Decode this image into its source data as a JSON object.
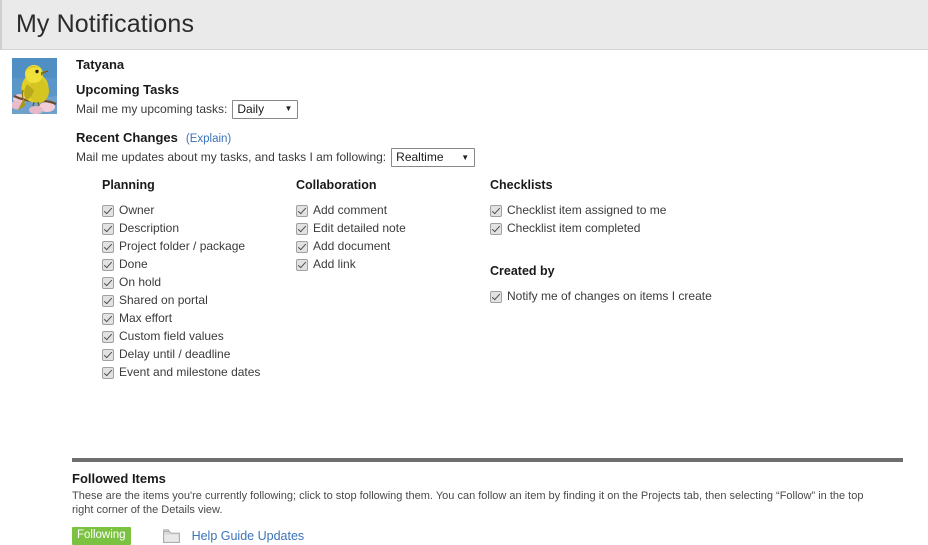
{
  "header": {
    "title": "My Notifications"
  },
  "profile": {
    "avatar_icon": "bird-avatar",
    "user_name": "Tatyana"
  },
  "upcoming_tasks": {
    "heading": "Upcoming Tasks",
    "label": "Mail me my upcoming tasks:",
    "frequency_value": "Daily",
    "frequency_options": [
      "Daily"
    ],
    "caret_icon": "chevron-down-icon"
  },
  "recent_changes": {
    "heading": "Recent Changes",
    "explain_link": "(Explain)",
    "label": "Mail me updates about my tasks, and tasks I am following:",
    "frequency_value": "Realtime",
    "frequency_options": [
      "Realtime"
    ],
    "caret_icon": "chevron-down-icon"
  },
  "columns": {
    "planning": {
      "title": "Planning",
      "items": [
        {
          "label": "Owner",
          "checked": true
        },
        {
          "label": "Description",
          "checked": true
        },
        {
          "label": "Project folder / package",
          "checked": true
        },
        {
          "label": "Done",
          "checked": true
        },
        {
          "label": "On hold",
          "checked": true
        },
        {
          "label": "Shared on portal",
          "checked": true
        },
        {
          "label": "Max effort",
          "checked": true
        },
        {
          "label": "Custom field values",
          "checked": true
        },
        {
          "label": "Delay until / deadline",
          "checked": true
        },
        {
          "label": "Event and milestone dates",
          "checked": true
        }
      ]
    },
    "collaboration": {
      "title": "Collaboration",
      "items": [
        {
          "label": "Add comment",
          "checked": true
        },
        {
          "label": "Edit detailed note",
          "checked": true
        },
        {
          "label": "Add document",
          "checked": true
        },
        {
          "label": "Add link",
          "checked": true
        }
      ]
    },
    "checklists": {
      "title": "Checklists",
      "items": [
        {
          "label": "Checklist item assigned to me",
          "checked": true
        },
        {
          "label": "Checklist item completed",
          "checked": true
        }
      ]
    },
    "created_by": {
      "title": "Created by",
      "items": [
        {
          "label": "Notify me of changes on items I create",
          "checked": true
        }
      ]
    }
  },
  "followed_items": {
    "title": "Followed Items",
    "description": "These are the items you're currently following; click to stop following them. You can follow an item by finding it on the Projects tab, then selecting “Follow” in the top right corner of the Details view.",
    "rows": [
      {
        "badge": "Following",
        "icon": "folder-icon",
        "name": "Help Guide Updates"
      }
    ]
  },
  "colors": {
    "header_bg": "#eaeaea",
    "link": "#3b73b9",
    "following_badge": "#7cc242",
    "divider": "#6e6e6e"
  }
}
